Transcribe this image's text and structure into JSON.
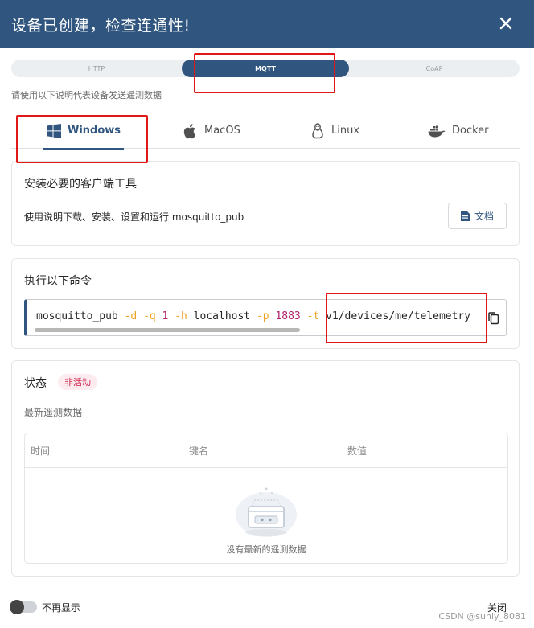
{
  "dialog": {
    "title": "设备已创建，检查连通性!",
    "close_icon": "close-icon"
  },
  "protocol_tabs": [
    {
      "label": "HTTP",
      "active": false
    },
    {
      "label": "MQTT",
      "active": true
    },
    {
      "label": "CoAP",
      "active": false
    }
  ],
  "hint": "请使用以下说明代表设备发送遥测数据",
  "os_tabs": [
    {
      "label": "Windows",
      "icon": "windows-icon",
      "active": true
    },
    {
      "label": "MacOS",
      "icon": "apple-icon",
      "active": false
    },
    {
      "label": "Linux",
      "icon": "linux-icon",
      "active": false
    },
    {
      "label": "Docker",
      "icon": "docker-icon",
      "active": false
    }
  ],
  "install_card": {
    "title": "安装必要的客户端工具",
    "text": "使用说明下载、安装、设置和运行 mosquitto_pub",
    "doc_button": "文档"
  },
  "command_card": {
    "title": "执行以下命令",
    "cmd": {
      "t1": "mosquitto_pub ",
      "f1": "-d",
      "s1": " ",
      "f2": "-q",
      "s2": " ",
      "n1": "1",
      "s3": " ",
      "f3": "-h",
      "t2": " localhost ",
      "f4": "-p",
      "s4": " ",
      "n2": "1883",
      "s5": " ",
      "f5": "-t",
      "t3": " v1/devices/me/telemetry"
    }
  },
  "status_card": {
    "title": "状态",
    "badge": "非活动",
    "subtitle": "最新遥测数据",
    "columns": [
      "时间",
      "键名",
      "数值"
    ],
    "empty_text": "没有最新的遥测数据"
  },
  "footer": {
    "dont_show": "不再显示",
    "close": "关闭",
    "watermark": "CSDN @sunly_8081"
  },
  "colors": {
    "primary": "#305680",
    "highlight": "#e01818",
    "badge_text": "#d0204a"
  }
}
